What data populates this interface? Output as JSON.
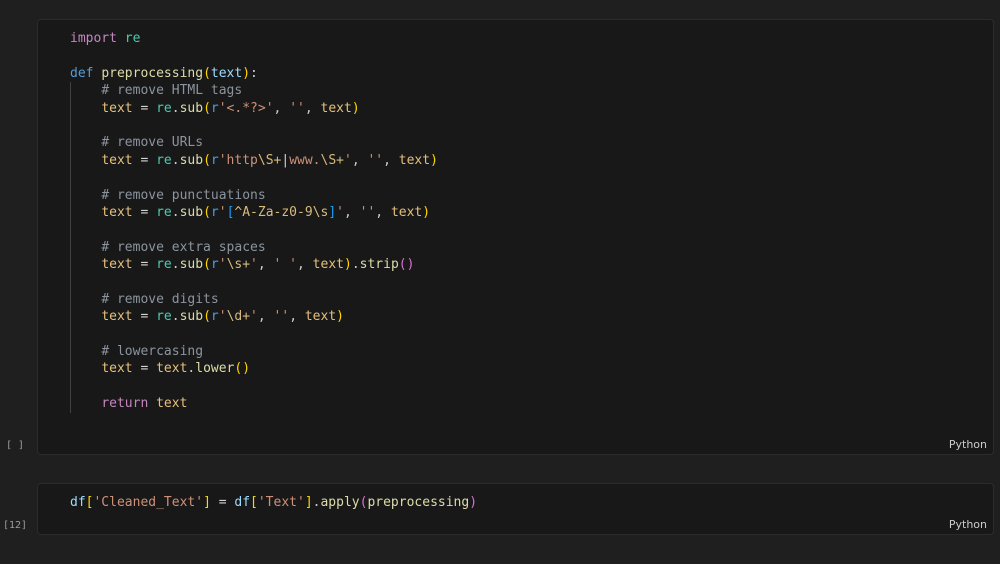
{
  "cells": [
    {
      "exec_count": "[ ]",
      "language": "Python",
      "lines": [
        [
          [
            "kw",
            "import"
          ],
          [
            "pl",
            " "
          ],
          [
            "mod",
            "re"
          ]
        ],
        [],
        [
          [
            "kw2",
            "def"
          ],
          [
            "pl",
            " "
          ],
          [
            "fn",
            "preprocessing"
          ],
          [
            "br1",
            "("
          ],
          [
            "var",
            "text"
          ],
          [
            "br1",
            ")"
          ],
          [
            "pl",
            ":"
          ]
        ],
        [
          [
            "pl",
            "    "
          ],
          [
            "cm",
            "# remove HTML tags"
          ]
        ],
        [
          [
            "pl",
            "    "
          ],
          [
            "var2",
            "text"
          ],
          [
            "op",
            " = "
          ],
          [
            "mod",
            "re"
          ],
          [
            "pl",
            "."
          ],
          [
            "fn",
            "sub"
          ],
          [
            "br1",
            "("
          ],
          [
            "kw2",
            "r"
          ],
          [
            "str",
            "'<.*?>'"
          ],
          [
            "pl",
            ", "
          ],
          [
            "str",
            "''"
          ],
          [
            "pl",
            ", "
          ],
          [
            "var2",
            "text"
          ],
          [
            "br1",
            ")"
          ]
        ],
        [],
        [
          [
            "pl",
            "    "
          ],
          [
            "cm",
            "# remove URLs"
          ]
        ],
        [
          [
            "pl",
            "    "
          ],
          [
            "var2",
            "text"
          ],
          [
            "op",
            " = "
          ],
          [
            "mod",
            "re"
          ],
          [
            "pl",
            "."
          ],
          [
            "fn",
            "sub"
          ],
          [
            "br1",
            "("
          ],
          [
            "kw2",
            "r"
          ],
          [
            "str",
            "'http"
          ],
          [
            "str2",
            "\\S+"
          ],
          [
            "op",
            "|"
          ],
          [
            "str",
            "www."
          ],
          [
            "str2",
            "\\S+"
          ],
          [
            "str",
            "'"
          ],
          [
            "pl",
            ", "
          ],
          [
            "str",
            "''"
          ],
          [
            "pl",
            ", "
          ],
          [
            "var2",
            "text"
          ],
          [
            "br1",
            ")"
          ]
        ],
        [],
        [
          [
            "pl",
            "    "
          ],
          [
            "cm",
            "# remove punctuations"
          ]
        ],
        [
          [
            "pl",
            "    "
          ],
          [
            "var2",
            "text"
          ],
          [
            "op",
            " = "
          ],
          [
            "mod",
            "re"
          ],
          [
            "pl",
            "."
          ],
          [
            "fn",
            "sub"
          ],
          [
            "br1",
            "("
          ],
          [
            "kw2",
            "r"
          ],
          [
            "str",
            "'"
          ],
          [
            "br3",
            "["
          ],
          [
            "str2",
            "^A-Za-z0-9\\s"
          ],
          [
            "br3",
            "]"
          ],
          [
            "str",
            "'"
          ],
          [
            "pl",
            ", "
          ],
          [
            "str",
            "''"
          ],
          [
            "pl",
            ", "
          ],
          [
            "var2",
            "text"
          ],
          [
            "br1",
            ")"
          ]
        ],
        [],
        [
          [
            "pl",
            "    "
          ],
          [
            "cm",
            "# remove extra spaces"
          ]
        ],
        [
          [
            "pl",
            "    "
          ],
          [
            "var2",
            "text"
          ],
          [
            "op",
            " = "
          ],
          [
            "mod",
            "re"
          ],
          [
            "pl",
            "."
          ],
          [
            "fn",
            "sub"
          ],
          [
            "br1",
            "("
          ],
          [
            "kw2",
            "r"
          ],
          [
            "str",
            "'"
          ],
          [
            "str2",
            "\\s+"
          ],
          [
            "str",
            "'"
          ],
          [
            "pl",
            ", "
          ],
          [
            "str",
            "' '"
          ],
          [
            "pl",
            ", "
          ],
          [
            "var2",
            "text"
          ],
          [
            "br1",
            ")"
          ],
          [
            "pl",
            "."
          ],
          [
            "fn",
            "strip"
          ],
          [
            "br2",
            "()"
          ]
        ],
        [],
        [
          [
            "pl",
            "    "
          ],
          [
            "cm",
            "# remove digits"
          ]
        ],
        [
          [
            "pl",
            "    "
          ],
          [
            "var2",
            "text"
          ],
          [
            "op",
            " = "
          ],
          [
            "mod",
            "re"
          ],
          [
            "pl",
            "."
          ],
          [
            "fn",
            "sub"
          ],
          [
            "br1",
            "("
          ],
          [
            "kw2",
            "r"
          ],
          [
            "str",
            "'"
          ],
          [
            "str2",
            "\\d+"
          ],
          [
            "str",
            "'"
          ],
          [
            "pl",
            ", "
          ],
          [
            "str",
            "''"
          ],
          [
            "pl",
            ", "
          ],
          [
            "var2",
            "text"
          ],
          [
            "br1",
            ")"
          ]
        ],
        [],
        [
          [
            "pl",
            "    "
          ],
          [
            "cm",
            "# lowercasing"
          ]
        ],
        [
          [
            "pl",
            "    "
          ],
          [
            "var2",
            "text"
          ],
          [
            "op",
            " = "
          ],
          [
            "var2",
            "text"
          ],
          [
            "pl",
            "."
          ],
          [
            "fn",
            "lower"
          ],
          [
            "br1",
            "()"
          ]
        ],
        [],
        [
          [
            "pl",
            "    "
          ],
          [
            "kw",
            "return"
          ],
          [
            "pl",
            " "
          ],
          [
            "var2",
            "text"
          ]
        ]
      ]
    },
    {
      "exec_count": "[12]",
      "language": "Python",
      "lines": [
        [
          [
            "var",
            "df"
          ],
          [
            "br1",
            "["
          ],
          [
            "str",
            "'Cleaned_Text'"
          ],
          [
            "br1",
            "]"
          ],
          [
            "op",
            " = "
          ],
          [
            "var",
            "df"
          ],
          [
            "br1",
            "["
          ],
          [
            "str",
            "'Text'"
          ],
          [
            "br1",
            "]"
          ],
          [
            "pl",
            "."
          ],
          [
            "fn",
            "apply"
          ],
          [
            "br2",
            "("
          ],
          [
            "fn",
            "preprocessing"
          ],
          [
            "br2",
            ")"
          ]
        ]
      ]
    }
  ],
  "colors": {
    "background": "#1f1f1f",
    "cell_background": "#181818",
    "keyword": "#c586c0",
    "function": "#dcdcaa",
    "string": "#ce9178",
    "comment": "#8b949e"
  }
}
